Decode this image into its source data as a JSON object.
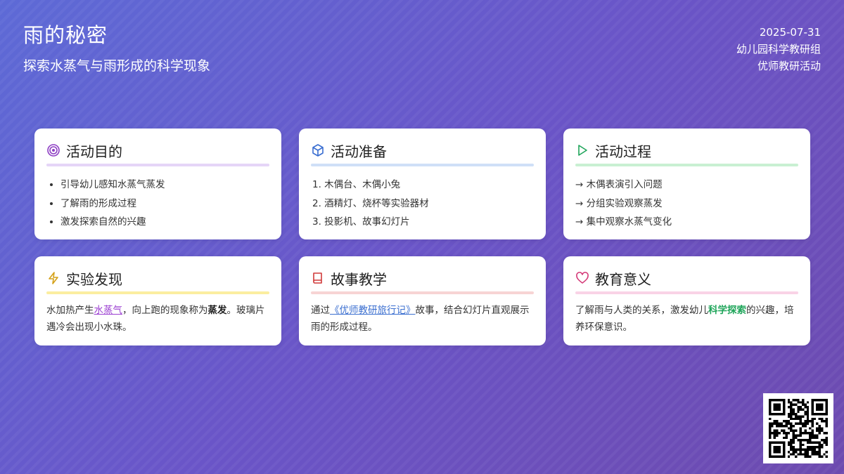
{
  "header": {
    "title": "雨的秘密",
    "subtitle": "探索水蒸气与雨形成的科学现象",
    "date": "2025-07-31",
    "group": "幼儿园科学教研组",
    "activity": "优师教研活动"
  },
  "cards": {
    "goal": {
      "title": "活动目的",
      "icon": "target-icon",
      "accent": "#e5d5f7",
      "items": [
        "引导幼儿感知水蒸气蒸发",
        "了解雨的形成过程",
        "激发探索自然的兴趣"
      ]
    },
    "prep": {
      "title": "活动准备",
      "icon": "cube-icon",
      "accent": "#cfe0f7",
      "items": [
        "1. 木偶台、木偶小兔",
        "2. 酒精灯、烧杯等实验器材",
        "3. 投影机、故事幻灯片"
      ]
    },
    "process": {
      "title": "活动过程",
      "icon": "play-icon",
      "accent": "#c9f0d2",
      "items": [
        "→ 木偶表演引入问题",
        "→ 分组实验观察蒸发",
        "→ 集中观察水蒸气变化"
      ]
    },
    "finding": {
      "title": "实验发现",
      "icon": "lightning-icon",
      "accent": "#fbeea0",
      "text_a": "水加热产生",
      "text_hl": "水蒸气",
      "text_b": "，向上跑的现象称为",
      "text_bold": "蒸发",
      "text_c": "。玻璃片遇冷会出现小水珠。"
    },
    "story": {
      "title": "故事教学",
      "icon": "book-icon",
      "accent": "#f7d4d4",
      "text_a": "通过",
      "text_link": "《优师教研旅行记》",
      "text_b": "故事，结合幻灯片直观展示雨的形成过程。"
    },
    "meaning": {
      "title": "教育意义",
      "icon": "heart-icon",
      "accent": "#f9d3e6",
      "text_a": "了解雨与人类的关系，激发幼儿",
      "text_hl": "科学探索",
      "text_b": "的兴趣，培养环保意识。"
    }
  },
  "qr": {
    "icon": "qr-code-icon"
  }
}
